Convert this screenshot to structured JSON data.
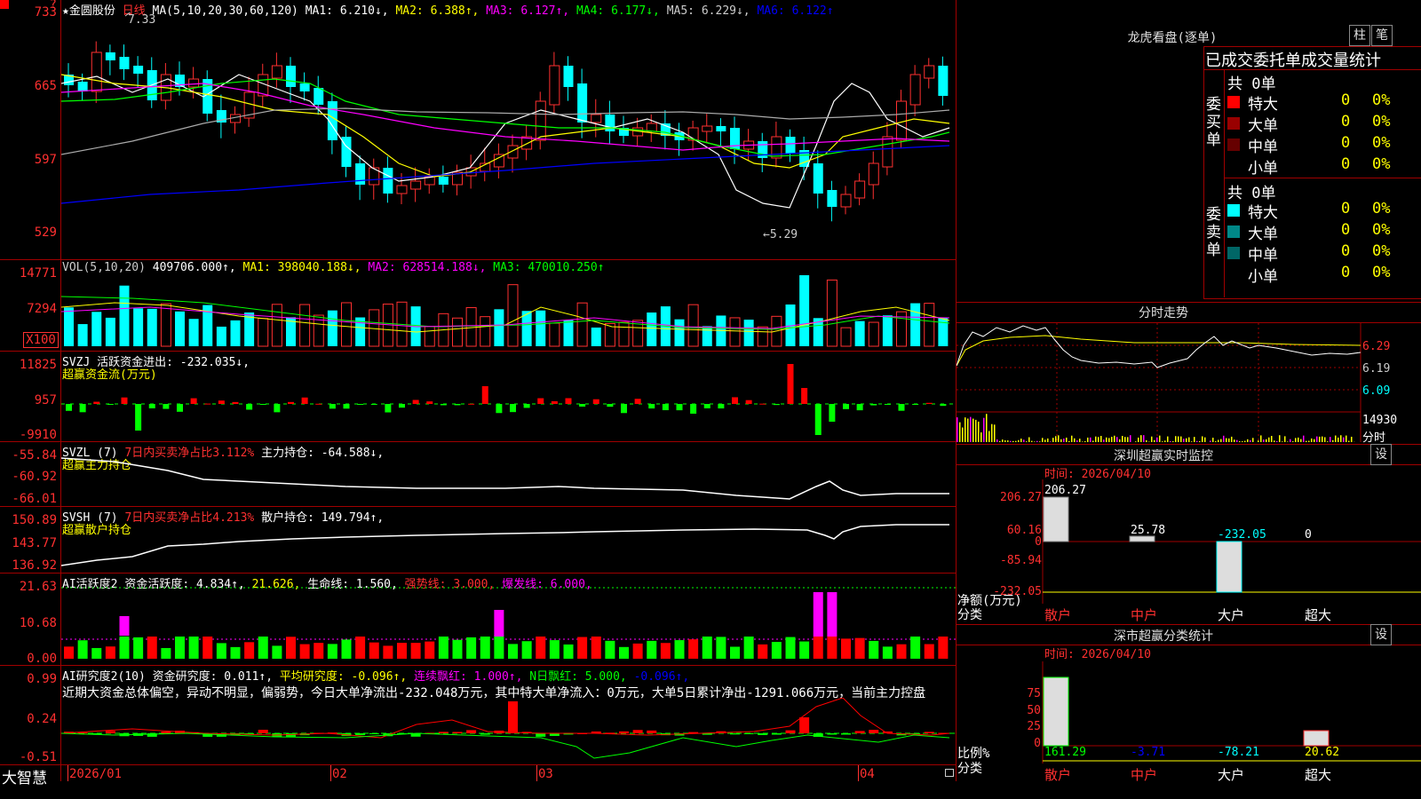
{
  "stock": {
    "name": "★金圆股份",
    "period": "日线",
    "ma_label": "MA(5,10,20,30,60,120)",
    "ma1": "MA1: 6.210↓,",
    "ma2": "MA2: 6.388↑,",
    "ma3": "MA3: 6.127↑,",
    "ma4": "MA4: 6.177↓,",
    "ma5": "MA5: 6.229↓,",
    "ma6": "MA6: 6.122↑",
    "high_mark": "7.33",
    "low_mark": "5.29",
    "y_labels": [
      "733",
      "665",
      "597",
      "529"
    ]
  },
  "vol": {
    "label": "VOL(5,10,20)",
    "value": "409706.000↑,",
    "ma1": "MA1: 398040.188↓,",
    "ma2": "MA2: 628514.188↓,",
    "ma3": "MA3: 470010.250↑",
    "y_labels": [
      "14771",
      "7294",
      "X100"
    ]
  },
  "svzj": {
    "label": "SVZJ  活跃资金进出: -232.035↓,",
    "sub": "超赢资金流(万元)",
    "y_labels": [
      "11825",
      "957",
      "-9910"
    ]
  },
  "svzl": {
    "label": "SVZL (7)",
    "pct": "7日内买卖净占比3.112%",
    "pos": "主力持仓: -64.588↓,",
    "sub": "超赢主力持仓",
    "y_labels": [
      "-55.84",
      "-60.92",
      "-66.01"
    ]
  },
  "svsh": {
    "label": "SVSH (7)",
    "pct": "7日内买卖净占比4.213%",
    "pos": "散户持仓: 149.794↑,",
    "sub": "超赢散户持仓",
    "y_labels": [
      "150.89",
      "143.77",
      "136.92"
    ]
  },
  "ai1": {
    "label": "AI活跃度2",
    "a": "资金活跃度: 4.834↑,",
    "b": "21.626,",
    "c": "生命线: 1.560,",
    "d": "强势线: 3.000,",
    "e": "爆发线: 6.000,",
    "y_labels": [
      "21.63",
      "10.68",
      "0.00"
    ]
  },
  "ai2": {
    "label": "AI研究度2(10)",
    "a": "资金研究度: 0.011↑,",
    "b": "平均研究度: -0.096↑,",
    "c": "连续飘红: 1.000↑,",
    "d": "N日飘红: 5.000,",
    "e": "-0.096↑,",
    "desc": "近期大资金总体偏空，异动不明显，偏弱势，今日大单净流出-232.048万元，其中特大单净流入：0万元，大单5日累计净出-1291.066万元，当前主力控盘",
    "y_labels": [
      "0.99",
      "0.24",
      "-0.51"
    ]
  },
  "xaxis": {
    "labels": [
      "2026/01",
      "02",
      "03",
      "04"
    ]
  },
  "brand": "大智慧",
  "right": {
    "lhb_title": "龙虎看盘(逐单)",
    "btn_zhu": "柱",
    "btn_bi": "笔",
    "stats_title": "已成交委托单成交量统计",
    "buy_side": "委买单",
    "sell_side": "委卖单",
    "buy_total": "共 0单",
    "sell_total": "共 0单",
    "buy_rows": [
      {
        "label": "特大",
        "value": "0",
        "pct": "0%",
        "color": "#ff0000"
      },
      {
        "label": "大单",
        "value": "0",
        "pct": "0%",
        "color": "#990000"
      },
      {
        "label": "中单",
        "value": "0",
        "pct": "0%",
        "color": "#660000"
      },
      {
        "label": "小单",
        "value": "0",
        "pct": "0%",
        "color": "#000000"
      }
    ],
    "sell_rows": [
      {
        "label": "特大",
        "value": "0",
        "pct": "0%",
        "color": "#00ffff"
      },
      {
        "label": "大单",
        "value": "0",
        "pct": "0%",
        "color": "#008888"
      },
      {
        "label": "中单",
        "value": "0",
        "pct": "0%",
        "color": "#006666"
      },
      {
        "label": "小单",
        "value": "0",
        "pct": "0%",
        "color": "#000000"
      }
    ],
    "fenshi_title": "分时走势",
    "fenshi_y": [
      "6.29",
      "6.19",
      "6.09",
      "14930",
      "分时"
    ],
    "sz_title": "深圳超赢实时监控",
    "sz_btn": "设",
    "sz_time": "时间: 2026/04/10",
    "sz_y": [
      "206.27",
      "60.16",
      "0",
      "-85.94",
      "-232.05"
    ],
    "sz_vals": [
      "206.27",
      "25.78",
      "-232.05",
      "0"
    ],
    "sz_left": [
      "净额(万元)",
      "分类"
    ],
    "cats": [
      "散户",
      "中户",
      "大户",
      "超大"
    ],
    "cls_title": "深市超赢分类统计",
    "cls_btn": "设",
    "cls_time": "时间: 2026/04/10",
    "cls_y": [
      "75",
      "50",
      "25",
      "0"
    ],
    "cls_vals": [
      "161.29",
      "-3.71",
      "-78.21",
      "20.62"
    ],
    "cls_left": [
      "比例%",
      "分类"
    ]
  }
}
